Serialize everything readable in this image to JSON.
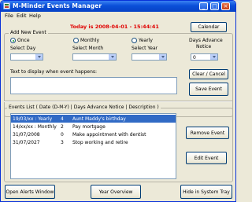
{
  "window": {
    "title": "M-Minder Events Manager"
  },
  "titlebar_buttons": {
    "minimize": "_",
    "maximize": "□",
    "close": "×"
  },
  "menu": [
    "File",
    "Edit",
    "Help"
  ],
  "today_text": "Today is 2008-04-01 - 15:44:41",
  "calendar_button": "Calendar",
  "add_group": {
    "label": "Add New Event",
    "radios": [
      {
        "label": "Once",
        "checked": true
      },
      {
        "label": "Monthly",
        "checked": false
      },
      {
        "label": "Yearly",
        "checked": false
      }
    ],
    "select_day": "Select Day",
    "select_month": "Select Month",
    "select_year": "Select Year",
    "days_advance_label": "Days Advance Notice",
    "days_advance_value": "0",
    "text_label": "Text to display when event happens:",
    "clear_button": "Clear / Cancel",
    "save_button": "Save Event"
  },
  "events_group": {
    "label": "Events List  ( Date (D-M-Y)  |  Days Advance Notice  |  Description )",
    "rows": [
      {
        "date": "19/03/xx : Yearly",
        "notice": "4",
        "description": "Aunt Maddy's birthday",
        "selected": true
      },
      {
        "date": "14/xx/xx : Monthly",
        "notice": "2",
        "description": "Pay mortgage",
        "selected": false
      },
      {
        "date": "31/07/2008",
        "notice": "0",
        "description": "Make appointment with dentist",
        "selected": false
      },
      {
        "date": "31/07/2027",
        "notice": "3",
        "description": "Stop working and retire",
        "selected": false
      }
    ],
    "remove_button": "Remove Event",
    "edit_button": "Edit Event"
  },
  "bottom_buttons": {
    "open_alerts": "Open Alerts Window",
    "year_overview": "Year Overview",
    "hide_tray": "Hide in System Tray"
  },
  "colors": {
    "today_text": "#e00000",
    "titlebar": "#0a4fd8",
    "selection": "#316ac5"
  }
}
